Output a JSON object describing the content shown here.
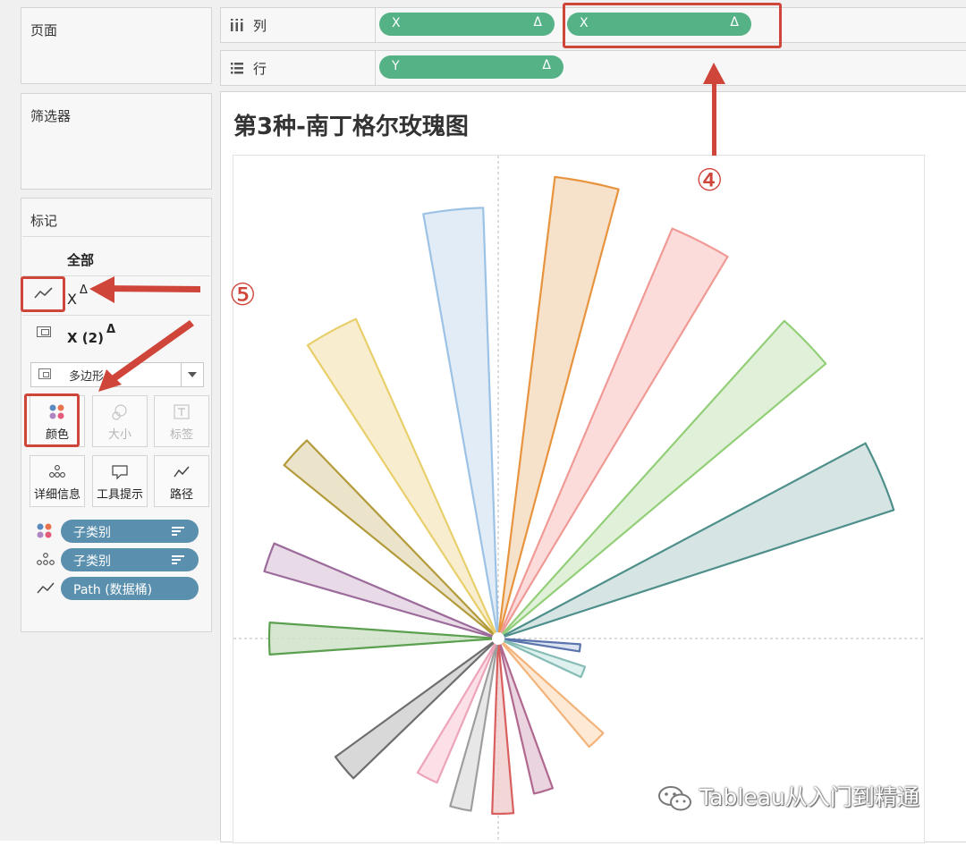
{
  "left_panel": {
    "pages_title": "页面",
    "filters_title": "筛选器",
    "marks": {
      "title": "标记",
      "all_label": "全部",
      "x_label": "X",
      "x2_label": "X (2)",
      "delta": "Δ",
      "mark_type": "多边形",
      "buttons": {
        "color": "颜色",
        "size": "大小",
        "label": "标签",
        "detail": "详细信息",
        "tooltip": "工具提示",
        "path": "路径"
      },
      "pills": {
        "color_field": "子类别",
        "detail_field": "子类别",
        "path_field": "Path (数据桶)"
      }
    }
  },
  "shelves": {
    "columns_label": "列",
    "rows_label": "行",
    "columns_pills": [
      {
        "text": "X",
        "delta": "Δ"
      },
      {
        "text": "X",
        "delta": "Δ"
      }
    ],
    "rows_pills": [
      {
        "text": "Y",
        "delta": "Δ"
      }
    ]
  },
  "view": {
    "title": "第3种-南丁格尔玫瑰图"
  },
  "annotations": {
    "step4": "④",
    "step5": "⑤"
  },
  "watermark": "Tableau从入门到精通",
  "colors": {
    "accent_red": "#d0453a",
    "pill_green": "#55b287",
    "pill_blue": "#5a8fae"
  },
  "chart_data": {
    "type": "rose",
    "angle_reference": "degrees clockwise from north",
    "petals": [
      {
        "start": 350,
        "end": 358,
        "r": 482,
        "fill": "#dce9f5",
        "stroke": "#9cc2e5"
      },
      {
        "start": 7,
        "end": 15,
        "r": 520,
        "fill": "#f5dcc2",
        "stroke": "#e8943f"
      },
      {
        "start": 23,
        "end": 31,
        "r": 498,
        "fill": "#fbd6d5",
        "stroke": "#f09a96"
      },
      {
        "start": 42,
        "end": 50,
        "r": 478,
        "fill": "#dcefd2",
        "stroke": "#93cf78"
      },
      {
        "start": 62,
        "end": 72,
        "r": 465,
        "fill": "#cfe0df",
        "stroke": "#4e8f8b"
      },
      {
        "start": 94,
        "end": 99,
        "r": 92,
        "fill": "#d6deee",
        "stroke": "#5a74ad"
      },
      {
        "start": 108,
        "end": 115,
        "r": 102,
        "fill": "#d8eeeb",
        "stroke": "#86bcb6"
      },
      {
        "start": 132,
        "end": 140,
        "r": 158,
        "fill": "#fde5cc",
        "stroke": "#f3b37a"
      },
      {
        "start": 160,
        "end": 167,
        "r": 178,
        "fill": "#e6cddb",
        "stroke": "#b0688f"
      },
      {
        "start": 175,
        "end": 182,
        "r": 196,
        "fill": "#f1d0d0",
        "stroke": "#d95f5f"
      },
      {
        "start": 189,
        "end": 196,
        "r": 195,
        "fill": "#e3e3e3",
        "stroke": "#9e9e9e"
      },
      {
        "start": 203,
        "end": 211,
        "r": 175,
        "fill": "#fadbe4",
        "stroke": "#eda4b9"
      },
      {
        "start": 226,
        "end": 234,
        "r": 225,
        "fill": "#d1d1d1",
        "stroke": "#6e6e6e"
      },
      {
        "start": 266,
        "end": 274,
        "r": 256,
        "fill": "#cfe2c8",
        "stroke": "#5aa04f"
      },
      {
        "start": 286,
        "end": 293,
        "r": 272,
        "fill": "#e4d3e2",
        "stroke": "#9c6b9b"
      },
      {
        "start": 309,
        "end": 316,
        "r": 308,
        "fill": "#e7dfc1",
        "stroke": "#b39b3c"
      },
      {
        "start": 327,
        "end": 336,
        "r": 391,
        "fill": "#f7ebc7",
        "stroke": "#e8cf6c"
      }
    ]
  }
}
